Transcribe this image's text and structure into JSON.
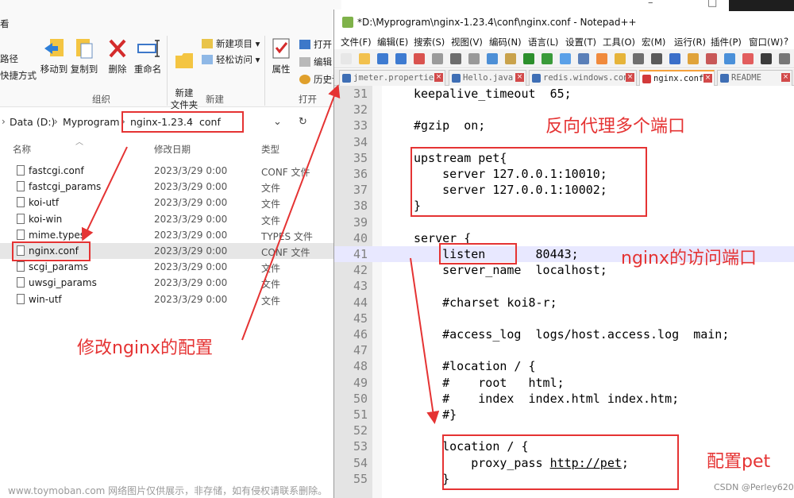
{
  "explorer": {
    "ribbon": {
      "frag_top": "看",
      "frag_path": "路径",
      "frag_shortcut": "快捷方式",
      "move_to": "移动到",
      "copy_to": "复制到",
      "delete": "删除",
      "rename": "重命名",
      "new_folder": "新建\n文件夹",
      "new_item": "新建项目 ▾",
      "easy_access": "轻松访问 ▾",
      "properties": "属性",
      "open": "打开 ▾",
      "edit": "编辑",
      "history": "历史记",
      "group_organize": "组织",
      "group_new": "新建",
      "group_open": "打开"
    },
    "address": {
      "crumbs": [
        "Data (D:)",
        "Myprogram",
        "nginx-1.23.4",
        "conf"
      ],
      "dropdown": "⌄",
      "refresh": "↻"
    },
    "columns": {
      "name": "名称",
      "date": "修改日期",
      "type": "类型"
    },
    "files": [
      {
        "name": "fastcgi.conf",
        "date": "2023/3/29 0:00",
        "type": "CONF 文件"
      },
      {
        "name": "fastcgi_params",
        "date": "2023/3/29 0:00",
        "type": "文件"
      },
      {
        "name": "koi-utf",
        "date": "2023/3/29 0:00",
        "type": "文件"
      },
      {
        "name": "koi-win",
        "date": "2023/3/29 0:00",
        "type": "文件"
      },
      {
        "name": "mime.types",
        "date": "2023/3/29 0:00",
        "type": "TYPES 文件"
      },
      {
        "name": "nginx.conf",
        "date": "2023/3/29 0:00",
        "type": "CONF 文件"
      },
      {
        "name": "scgi_params",
        "date": "2023/3/29 0:00",
        "type": "文件"
      },
      {
        "name": "uwsgi_params",
        "date": "2023/3/29 0:00",
        "type": "文件"
      },
      {
        "name": "win-utf",
        "date": "2023/3/29 0:00",
        "type": "文件"
      }
    ],
    "annotation": "修改nginx的配置"
  },
  "npp": {
    "title": "*D:\\Myprogram\\nginx-1.23.4\\conf\\nginx.conf - Notepad++",
    "menu": [
      "文件(F)",
      "编辑(E)",
      "搜索(S)",
      "视图(V)",
      "编码(N)",
      "语言(L)",
      "设置(T)",
      "工具(O)",
      "宏(M)",
      "运行(R)",
      "插件(P)",
      "窗口(W)",
      "?"
    ],
    "tabs": [
      {
        "label": "jmeter.properties",
        "active": false
      },
      {
        "label": "Hello.java",
        "active": false
      },
      {
        "label": "redis.windows.conf",
        "active": false
      },
      {
        "label": "nginx.conf",
        "active": true
      },
      {
        "label": "README",
        "active": false
      }
    ],
    "lines": [
      {
        "n": "31",
        "code": "keepalive_timeout  65;"
      },
      {
        "n": "32",
        "code": ""
      },
      {
        "n": "33",
        "code": "#gzip  on;"
      },
      {
        "n": "34",
        "code": ""
      },
      {
        "n": "35",
        "code": "upstream pet{"
      },
      {
        "n": "36",
        "code": "    server 127.0.0.1:10010;"
      },
      {
        "n": "37",
        "code": "    server 127.0.0.1:10002;"
      },
      {
        "n": "38",
        "code": "}"
      },
      {
        "n": "39",
        "code": ""
      },
      {
        "n": "40",
        "code": "server {"
      },
      {
        "n": "41",
        "code": "    listen       80443;"
      },
      {
        "n": "42",
        "code": "    server_name  localhost;"
      },
      {
        "n": "43",
        "code": ""
      },
      {
        "n": "44",
        "code": "    #charset koi8-r;"
      },
      {
        "n": "45",
        "code": ""
      },
      {
        "n": "46",
        "code": "    #access_log  logs/host.access.log  main;"
      },
      {
        "n": "47",
        "code": ""
      },
      {
        "n": "48",
        "code": "    #location / {"
      },
      {
        "n": "49",
        "code": "    #    root   html;"
      },
      {
        "n": "50",
        "code": "    #    index  index.html index.htm;"
      },
      {
        "n": "51",
        "code": "    #}"
      },
      {
        "n": "52",
        "code": ""
      },
      {
        "n": "53",
        "code": "    location / {"
      },
      {
        "n": "54",
        "code": "        proxy_pass http://pet;"
      },
      {
        "n": "55",
        "code": "    }"
      }
    ],
    "annotations": {
      "upstream": "反向代理多个端口",
      "listen": "nginx的访问端口",
      "location": "配置pet"
    }
  },
  "footer": {
    "watermark": "www.toymoban.com 网络图片仅供展示，非存储，如有侵权请联系删除。",
    "credit": "CSDN @Perley620"
  },
  "colors": {
    "annotation": "#e53333",
    "current_line": "#e8e8ff",
    "gutter": "#e4e4e4"
  }
}
